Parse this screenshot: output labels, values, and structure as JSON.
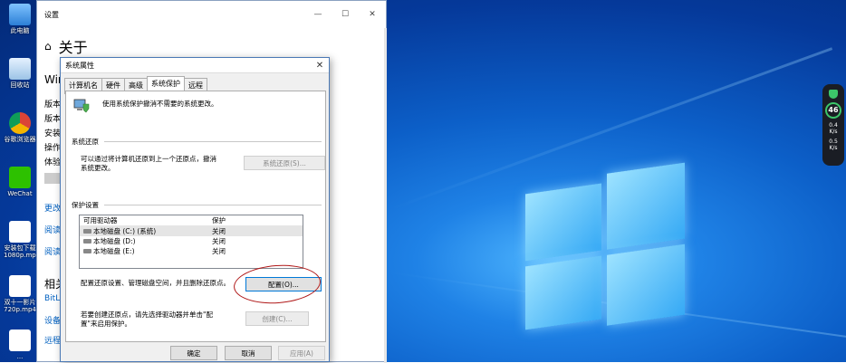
{
  "desktop": {
    "icons": [
      {
        "label": "此电脑"
      },
      {
        "label": "回收站"
      },
      {
        "label": "谷歌浏览器"
      },
      {
        "label": "WeChat"
      },
      {
        "label": "安装包下载1080p.mp4"
      },
      {
        "label": "双十一影片720p.mp4"
      },
      {
        "label": "..."
      }
    ]
  },
  "settings": {
    "title": "设置",
    "min": "—",
    "max": "☐",
    "close": "✕",
    "heading": "关于",
    "lines": [
      "Win",
      "版本",
      "版本",
      "安装",
      "操作",
      "体验"
    ],
    "links": [
      "更改",
      "阅读",
      "阅读"
    ],
    "related_heading": "相关",
    "related_links": [
      "BitLo",
      "设备",
      "远程"
    ]
  },
  "dialog": {
    "title": "系统属性",
    "close": "✕",
    "tabs": [
      "计算机名",
      "硬件",
      "高级",
      "系统保护",
      "远程"
    ],
    "active_tab": "系统保护",
    "intro": "使用系统保护撤消不需要的系统更改。",
    "restore_section": "系统还原",
    "restore_desc": "可以通过将计算机还原到上一个还原点，撤消系统更改。",
    "restore_button": "系统还原(S)...",
    "protection_section": "保护设置",
    "table_headers": [
      "可用驱动器",
      "保护"
    ],
    "drives": [
      {
        "name": "本地磁盘 (C:) (系统)",
        "status": "关闭"
      },
      {
        "name": "本地磁盘 (D:)",
        "status": "关闭"
      },
      {
        "name": "本地磁盘 (E:)",
        "status": "关闭"
      }
    ],
    "configure_desc": "配置还原设置、管理磁盘空间，并且删除还原点。",
    "configure_button": "配置(O)...",
    "create_desc": "若要创建还原点，请先选择驱动器并单击\"配置\"来启用保护。",
    "create_button": "创建(C)...",
    "ok_button": "确定",
    "cancel_button": "取消",
    "apply_button": "应用(A)"
  },
  "widget": {
    "score": "46",
    "up": "0.4",
    "up_unit": "K/s",
    "down": "0.5",
    "down_unit": "K/s"
  }
}
